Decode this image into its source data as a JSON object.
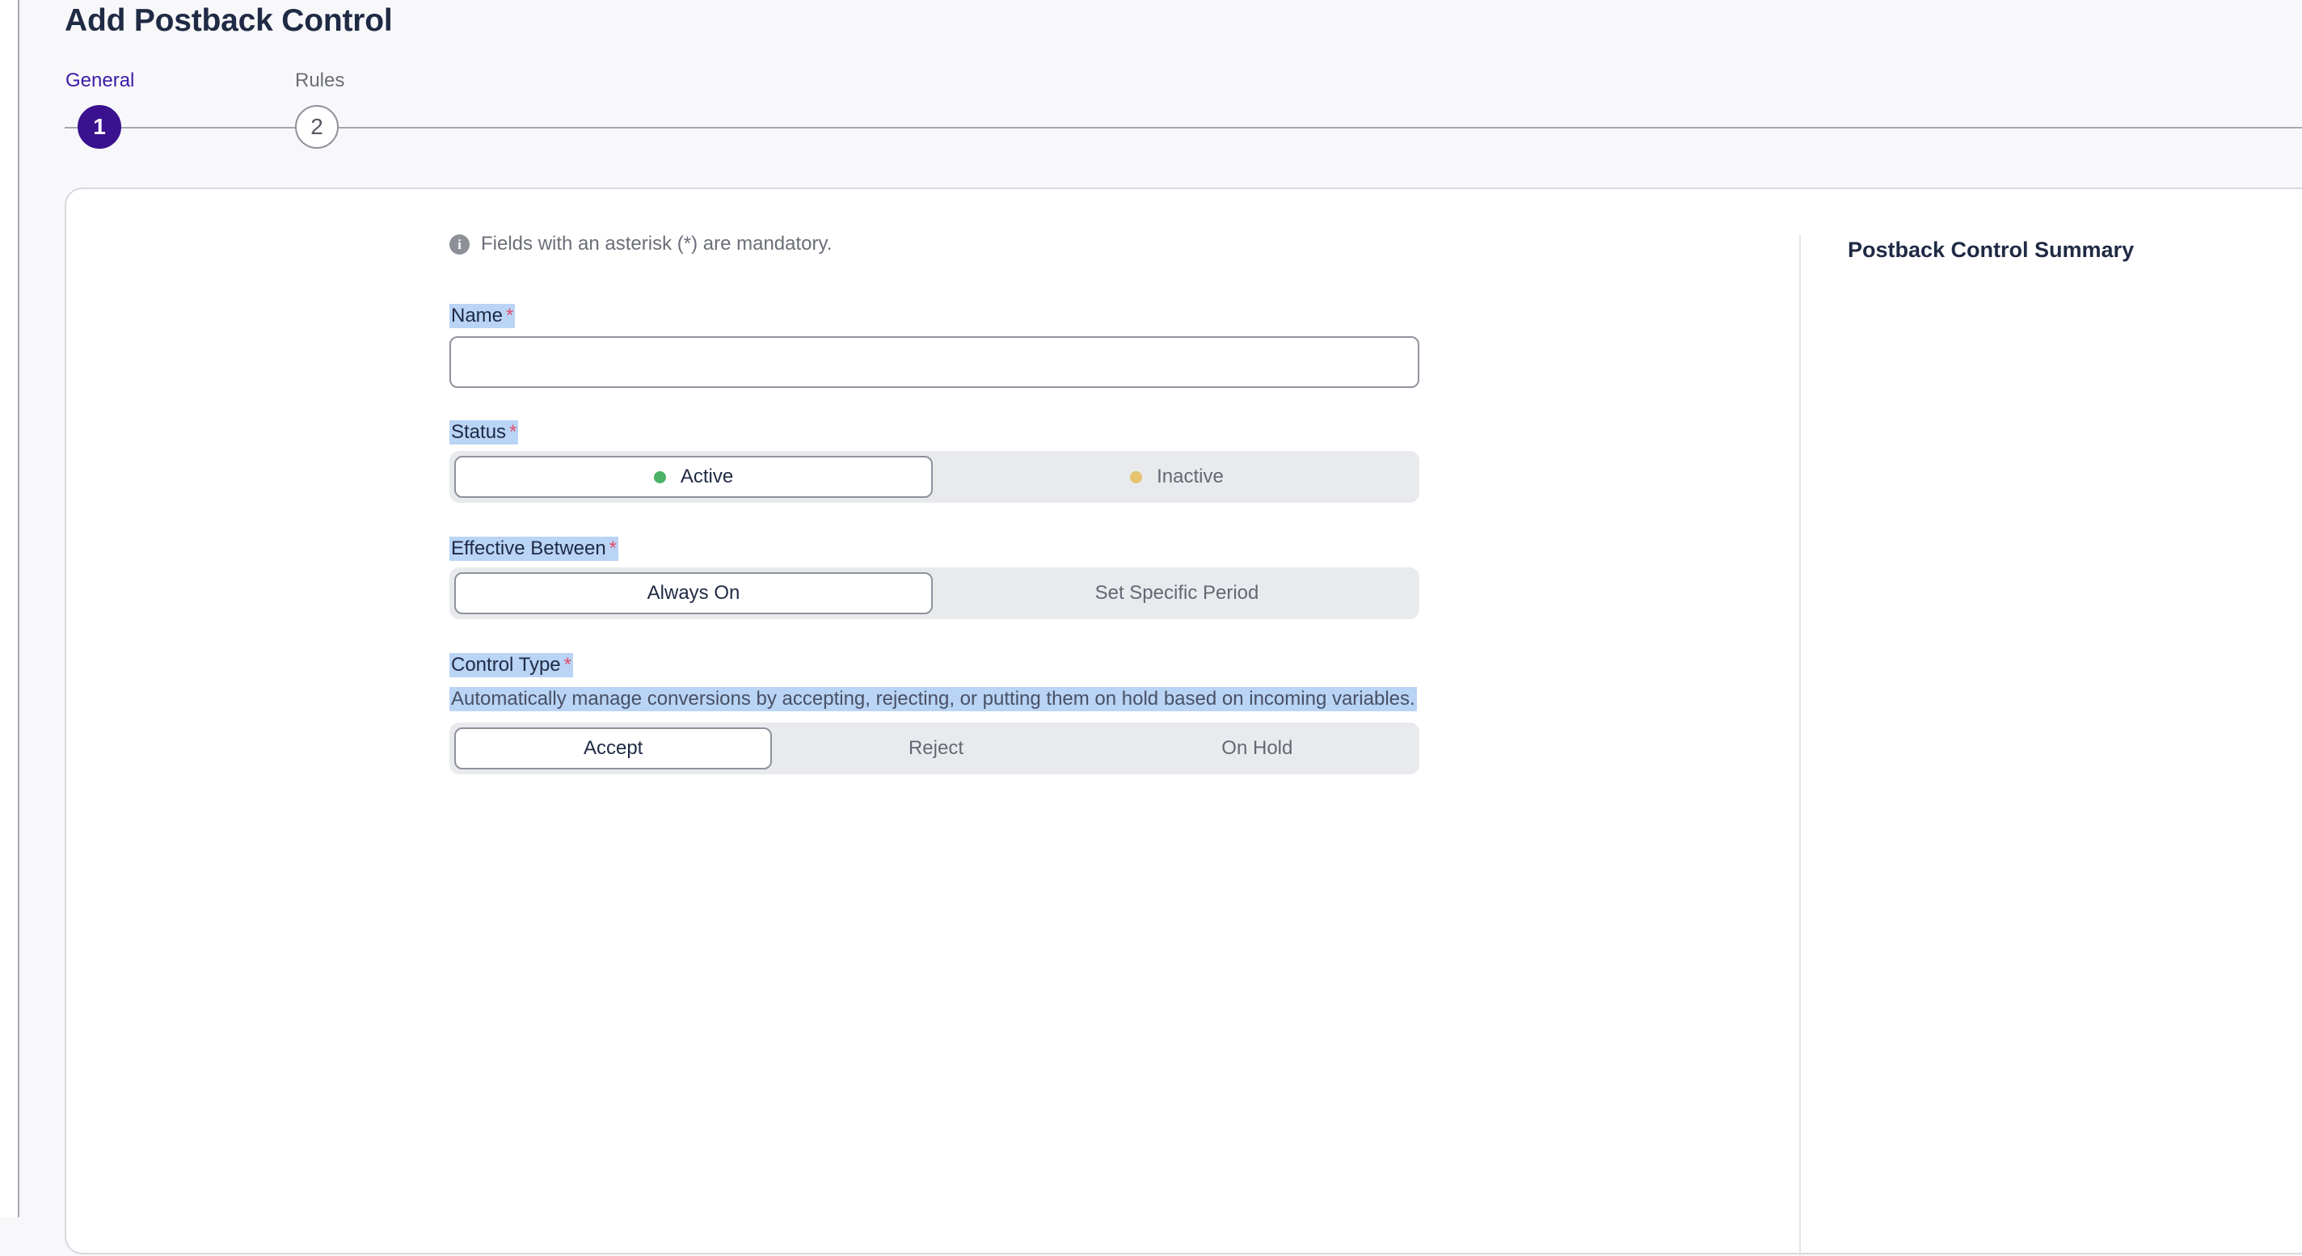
{
  "page": {
    "title": "Add Postback Control"
  },
  "stepper": {
    "steps": [
      {
        "label": "General",
        "number": "1",
        "active": true
      },
      {
        "label": "Rules",
        "number": "2",
        "active": false
      }
    ]
  },
  "form": {
    "info_text": "Fields with an asterisk (*) are mandatory.",
    "info_icon": "info-icon",
    "required_marker": "*",
    "name": {
      "label": "Name",
      "value": "",
      "placeholder": ""
    },
    "status": {
      "label": "Status",
      "options": [
        {
          "label": "Active",
          "selected": true,
          "dot_color": "#4bb365"
        },
        {
          "label": "Inactive",
          "selected": false,
          "dot_color": "#e6c36f"
        }
      ]
    },
    "effective_between": {
      "label": "Effective Between",
      "options": [
        {
          "label": "Always On",
          "selected": true
        },
        {
          "label": "Set Specific Period",
          "selected": false
        }
      ]
    },
    "control_type": {
      "label": "Control Type",
      "help_text": "Automatically manage conversions by accepting, rejecting, or putting them on hold based on incoming variables.",
      "options": [
        {
          "label": "Accept",
          "selected": true
        },
        {
          "label": "Reject",
          "selected": false
        },
        {
          "label": "On Hold",
          "selected": false
        }
      ]
    }
  },
  "summary": {
    "title": "Postback Control Summary"
  },
  "colors": {
    "primary": "#3a128f",
    "active_step_text": "#3b1aa5",
    "required": "#e34f6e",
    "selection_highlight": "#b9d4f5",
    "status_active": "#4bb365",
    "status_inactive": "#e6c36f"
  }
}
